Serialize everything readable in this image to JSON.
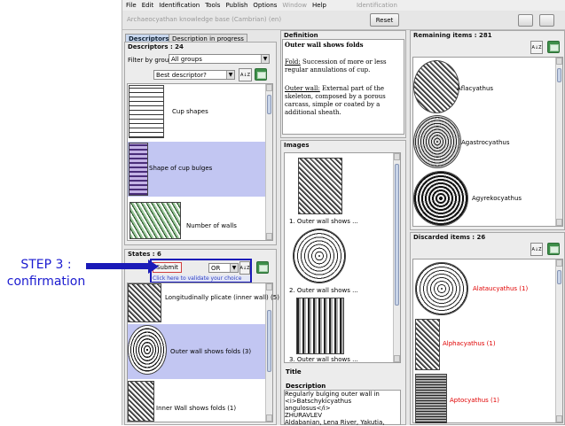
{
  "menu": [
    "File",
    "Edit",
    "Identification",
    "Tools",
    "Publish",
    "Options",
    "Window",
    "Help"
  ],
  "menu_disabled": "Window",
  "window_title": "Identification",
  "kb_title": "Archaeocyathan knowledge base (Cambrian) (en)",
  "reset_label": "Reset",
  "tabs": {
    "descriptors": "Descriptors",
    "progress": "Description in progress"
  },
  "descriptors": {
    "title": "Descriptors : 24",
    "filter_label": "Filter by group",
    "filter_value": "All groups",
    "sort_value": "Best descriptor?",
    "items": [
      "Cup shapes",
      "Shape of cup bulges",
      "Number of walls"
    ]
  },
  "states": {
    "title": "States : 6",
    "submit": "Submit",
    "operator": "OR",
    "hint": "Click here to validate your choice",
    "items": [
      "Longitudinally plicate (inner wall) (5)",
      "Outer wall shows folds (3)",
      "Inner Wall shows folds (1)"
    ]
  },
  "definition": {
    "section": "Definition",
    "title": "Outer wall shows folds",
    "fold_term": "Fold:",
    "fold_text": "Succession of more or less regular annulations of cup.",
    "outer_term": "Outer wall:",
    "outer_text": "External part of the skeleton, composed by a porous carcass, simple or coated by a additional sheath."
  },
  "images": {
    "section": "Images",
    "captions": [
      "1. Outer wall shows ...",
      "2. Outer wall shows ...",
      "3. Outer wall shows ..."
    ]
  },
  "title_section": "Title",
  "description": {
    "section": "Description",
    "lines": [
      "Regularly bulging outer wall in",
      "<i>Batschykicyathus angulosus</i>",
      "ZHURAVLEV",
      "Aldabanian, Lena River, Yakutia,"
    ]
  },
  "remaining": {
    "title": "Remaining items : 281",
    "items": [
      "Aflacyathus",
      "Agastrocyathus",
      "Agyrekocyathus"
    ]
  },
  "discarded": {
    "title": "Discarded items : 26",
    "items": [
      "Alataucyathus (1)",
      "Alphacyathus (1)",
      "Aptocyathus (1)"
    ]
  },
  "annotation": {
    "line1": "STEP 3 :",
    "line2": "confirmation"
  },
  "colors": {
    "annotation": "#1b1bd0",
    "selected_row": "#c2c6f2",
    "discarded_text": "#e00000"
  }
}
